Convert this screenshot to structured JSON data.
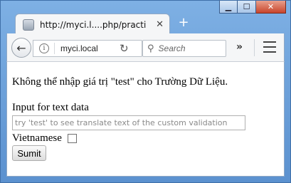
{
  "window": {
    "controls": {
      "minimize": "▁",
      "maximize": "☐",
      "close": "✕"
    }
  },
  "tab": {
    "title": "http://myci.l....php/practice",
    "close": "✕",
    "new_tab": "+"
  },
  "toolbar": {
    "back": "←",
    "url": "myci.local",
    "info": "i",
    "reload": "↻",
    "search_placeholder": "Search",
    "search_icon": "⚲",
    "overflow": "»"
  },
  "page": {
    "error_message": "Không thể nhập giá trị \"test\" cho Trường Dữ Liệu.",
    "input_label": "Input for text data",
    "input_placeholder": "try 'test' to see translate text of the custom validation",
    "checkbox_label": "Vietnamese",
    "checkbox_checked": false,
    "submit_label": "Sumit"
  }
}
